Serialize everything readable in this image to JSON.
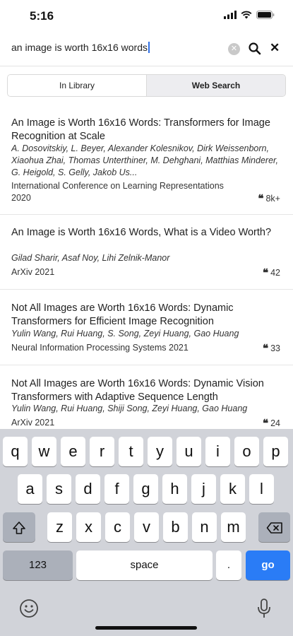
{
  "status_bar": {
    "time": "5:16",
    "icons": [
      "signal-icon",
      "wifi-icon",
      "battery-icon"
    ]
  },
  "search": {
    "query": "an image is worth 16x16 words",
    "clear_icon": "clear-icon",
    "search_icon": "search-icon",
    "close_icon": "close-icon"
  },
  "tabs": [
    {
      "label": "In Library",
      "active": false
    },
    {
      "label": "Web Search",
      "active": true
    }
  ],
  "results": [
    {
      "title": "An Image is Worth 16x16 Words: Transformers for Image Recognition at Scale",
      "authors": "A. Dosovitskiy, L. Beyer, Alexander Kolesnikov, Dirk Weissenborn, Xiaohua Zhai, Thomas Unterthiner, M. Dehghani, Matthias Minderer, G. Heigold, S. Gelly, Jakob Us...",
      "venue": "International Conference on Learning Representations",
      "year": "2020",
      "citations": "8k+"
    },
    {
      "title": "An Image is Worth 16x16 Words, What is a Video Worth?",
      "authors": "Gilad Sharir, Asaf Noy, Lihi Zelnik-Manor",
      "venue": "ArXiv 2021",
      "citations": "42"
    },
    {
      "title": "Not All Images are Worth 16x16 Words: Dynamic Transformers for Efficient Image Recognition",
      "authors": "Yulin Wang, Rui Huang, S. Song, Zeyi Huang, Gao Huang",
      "venue": "Neural Information Processing Systems 2021",
      "citations": "33"
    },
    {
      "title": "Not All Images are Worth 16x16 Words: Dynamic Vision Transformers with Adaptive Sequence Length",
      "authors": "Yulin Wang, Rui Huang, Shiji Song, Zeyi Huang, Gao Huang",
      "venue": "ArXiv 2021",
      "citations": "24"
    }
  ],
  "keyboard": {
    "row1": [
      "q",
      "w",
      "e",
      "r",
      "t",
      "y",
      "u",
      "i",
      "o",
      "p"
    ],
    "row2": [
      "a",
      "s",
      "d",
      "f",
      "g",
      "h",
      "j",
      "k",
      "l"
    ],
    "row3": [
      "z",
      "x",
      "c",
      "v",
      "b",
      "n",
      "m"
    ],
    "numbers_label": "123",
    "space_label": "space",
    "period_label": ".",
    "go_label": "go",
    "shift_icon": "shift-icon",
    "backspace_icon": "backspace-icon",
    "emoji_icon": "emoji-icon",
    "mic_icon": "microphone-icon",
    "accent_color": "#2a7cf6"
  }
}
